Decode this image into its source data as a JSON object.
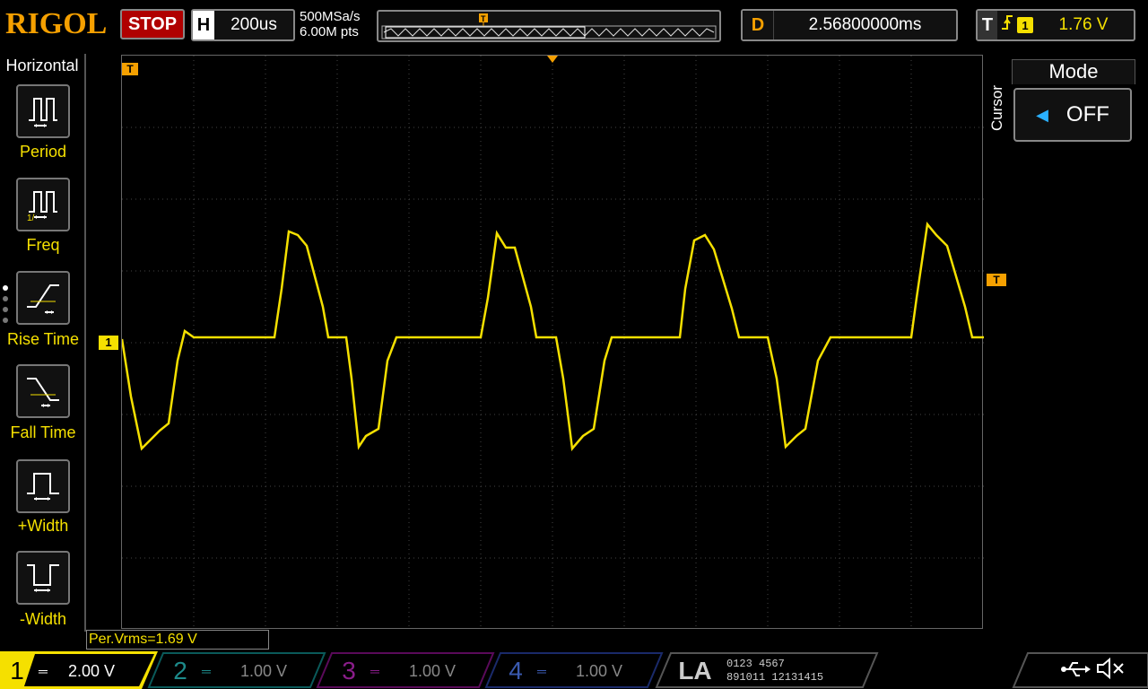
{
  "header": {
    "brand": "RIGOL",
    "run_state": "STOP",
    "horizontal_label": "H",
    "horizontal_scale": "200us",
    "sample_rate": "500MSa/s",
    "memory_depth": "6.00M pts",
    "delay_label": "D",
    "delay_value": "2.56800000ms",
    "trigger_label": "T",
    "trigger_slope_icon": "rising-edge-icon",
    "trigger_source": "1",
    "trigger_level": "1.76 V"
  },
  "left_menu": {
    "title": "Horizontal",
    "items": [
      {
        "label": "Period",
        "icon": "period-icon"
      },
      {
        "label": "Freq",
        "icon": "frequency-icon"
      },
      {
        "label": "Rise Time",
        "icon": "rise-time-icon"
      },
      {
        "label": "Fall Time",
        "icon": "fall-time-icon"
      },
      {
        "label": "+Width",
        "icon": "positive-width-icon"
      },
      {
        "label": "-Width",
        "icon": "negative-width-icon"
      }
    ]
  },
  "right_menu": {
    "section": "Cursor",
    "mode_title": "Mode",
    "mode_value": "OFF"
  },
  "markers": {
    "trigger_marker": "T",
    "channel1_marker": "1"
  },
  "measurement": "Per.Vrms=1.69 V",
  "channels": [
    {
      "num": "1",
      "scale": "2.00 V",
      "color": "#f5e000",
      "active": true
    },
    {
      "num": "2",
      "scale": "1.00 V",
      "color": "#00c0c0",
      "active": false
    },
    {
      "num": "3",
      "scale": "1.00 V",
      "color": "#c000c0",
      "active": false
    },
    {
      "num": "4",
      "scale": "1.00 V",
      "color": "#3070ff",
      "active": false
    }
  ],
  "la": {
    "label": "LA",
    "bits_row1": "0123 4567",
    "bits_row2": "891011 12131415"
  },
  "status_icons": [
    "usb-icon",
    "speaker-muted-icon"
  ],
  "colors": {
    "ch1": "#f5e000",
    "brand": "#f5a000",
    "stop": "#b00000"
  }
}
